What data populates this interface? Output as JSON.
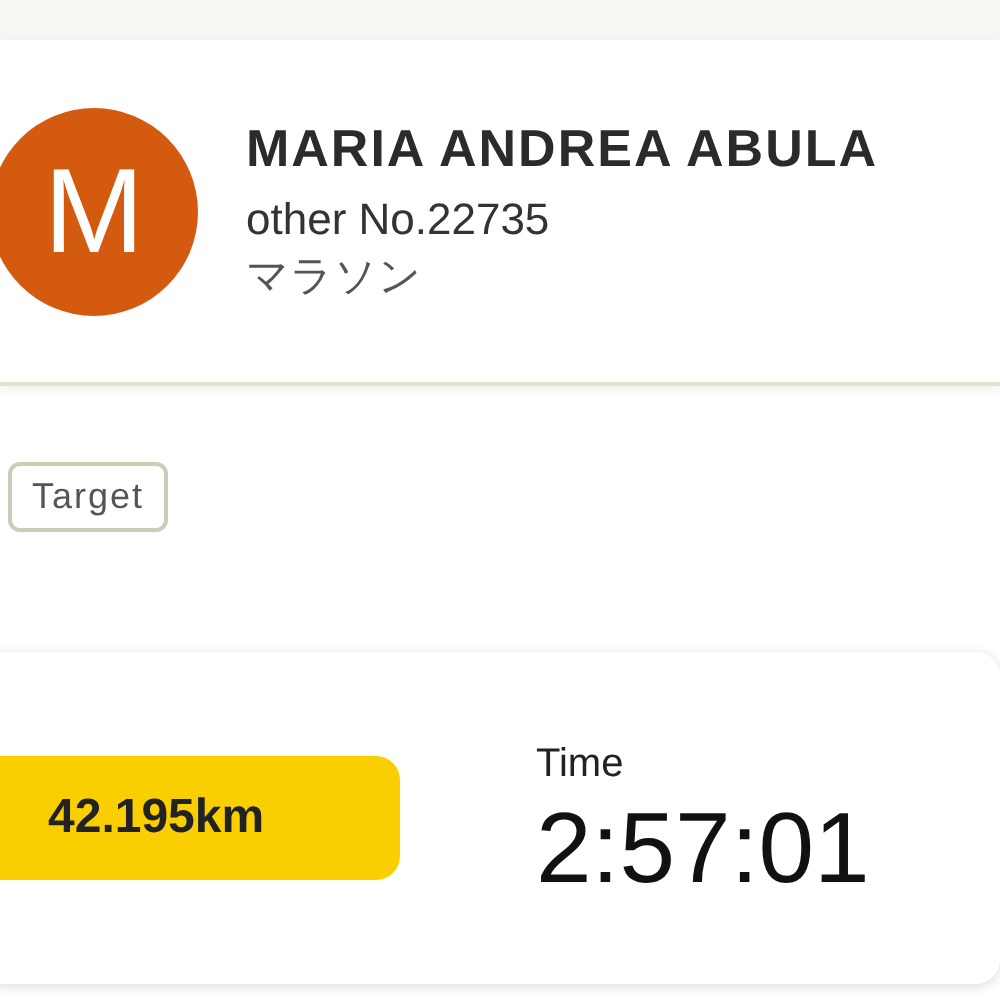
{
  "profile": {
    "avatar_letter": "M",
    "name": "MARIA ANDREA ABULA",
    "category_number": "other No.22735",
    "event": "マラソン"
  },
  "tag": "Target",
  "result": {
    "distance": "42.195km",
    "time_label": "Time",
    "time": "2:57:01"
  }
}
